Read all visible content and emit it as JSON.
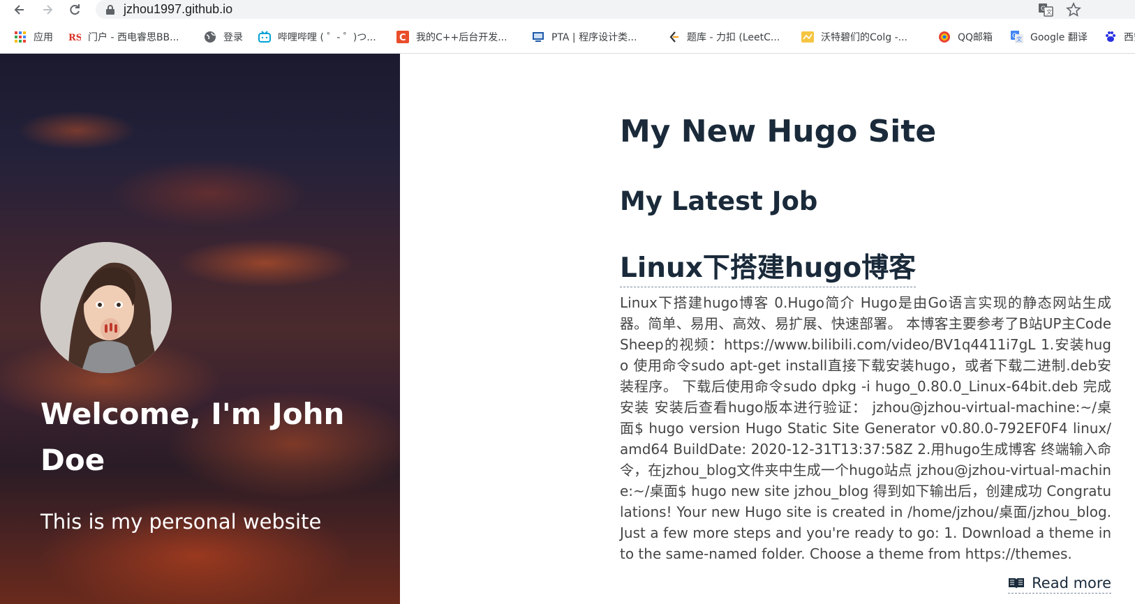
{
  "browser": {
    "url": "jzhou1997.github.io"
  },
  "bookmarks": [
    {
      "label": "应用",
      "icon": "apps-grid-icon"
    },
    {
      "label": "门户 - 西电睿思BB...",
      "icon": "rs-logo-icon"
    },
    {
      "label": "登录",
      "icon": "globe-icon"
    },
    {
      "label": "哔哩哔哩 ( ゜- ゜)つ...",
      "icon": "bilibili-icon"
    },
    {
      "label": "我的C++后台开发...",
      "icon": "csdn-icon"
    },
    {
      "label": "PTA | 程序设计类...",
      "icon": "pta-icon"
    },
    {
      "label": "题库 - 力扣 (LeetC...",
      "icon": "leetcode-icon"
    },
    {
      "label": "沃特碧们的Colg -...",
      "icon": "colg-icon"
    },
    {
      "label": "QQ邮箱",
      "icon": "qqmail-icon"
    },
    {
      "label": "Google 翻译",
      "icon": "google-translate-icon"
    },
    {
      "label": "西安",
      "icon": "baidu-paw-icon"
    }
  ],
  "hero": {
    "title": "Welcome, I'm John Doe",
    "subtitle": "This is my personal website"
  },
  "main": {
    "site_title": "My New Hugo Site",
    "section_title": "My Latest Job",
    "post": {
      "title": "Linux下搭建hugo博客",
      "summary": "Linux下搭建hugo博客 0.Hugo简介 Hugo是由Go语言实现的静态网站生成器。简单、易用、高效、易扩展、快速部署。 本博客主要参考了B站UP主CodeSheep的视频：https://www.bilibili.com/video/BV1q4411i7gL 1.安装hugo 使用命令sudo apt-get install直接下载安装hugo，或者下载二进制.deb安装程序。 下载后使用命令sudo dpkg -i hugo_0.80.0_Linux-64bit.deb 完成安装 安装后查看hugo版本进行验证： jzhou@jzhou-virtual-machine:~/桌面$ hugo version Hugo Static Site Generator v0.80.0-792EF0F4 linux/amd64 BuildDate: 2020-12-31T13:37:58Z 2.用hugo生成博客 终端输入命令，在jzhou_blog文件夹中生成一个hugo站点 jzhou@jzhou-virtual-machine:~/桌面$ hugo new site jzhou_blog 得到如下输出后，创建成功 Congratulations! Your new Hugo site is created in /home/jzhou/桌面/jzhou_blog. Just a few more steps and you're ready to go: 1. Download a theme into the same-named folder. Choose a theme from https://themes.",
      "read_more": "Read more"
    }
  },
  "colors": {
    "heading": "#1a2a3a",
    "body_text": "#444444",
    "hero_text": "#ffffff"
  }
}
